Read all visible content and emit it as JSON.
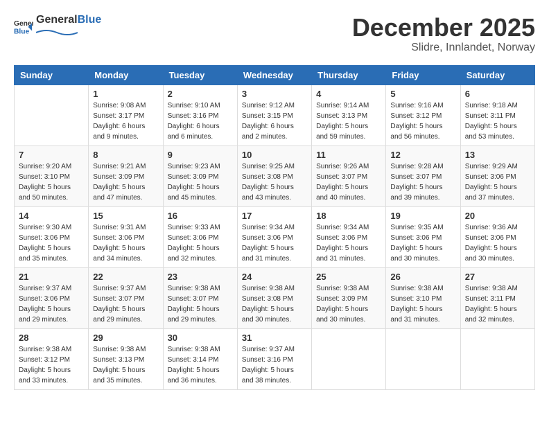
{
  "logo": {
    "general": "General",
    "blue": "Blue"
  },
  "header": {
    "month": "December 2025",
    "location": "Slidre, Innlandet, Norway"
  },
  "weekdays": [
    "Sunday",
    "Monday",
    "Tuesday",
    "Wednesday",
    "Thursday",
    "Friday",
    "Saturday"
  ],
  "weeks": [
    [
      {
        "day": "",
        "sunrise": "",
        "sunset": "",
        "daylight": ""
      },
      {
        "day": "1",
        "sunrise": "Sunrise: 9:08 AM",
        "sunset": "Sunset: 3:17 PM",
        "daylight": "Daylight: 6 hours and 9 minutes."
      },
      {
        "day": "2",
        "sunrise": "Sunrise: 9:10 AM",
        "sunset": "Sunset: 3:16 PM",
        "daylight": "Daylight: 6 hours and 6 minutes."
      },
      {
        "day": "3",
        "sunrise": "Sunrise: 9:12 AM",
        "sunset": "Sunset: 3:15 PM",
        "daylight": "Daylight: 6 hours and 2 minutes."
      },
      {
        "day": "4",
        "sunrise": "Sunrise: 9:14 AM",
        "sunset": "Sunset: 3:13 PM",
        "daylight": "Daylight: 5 hours and 59 minutes."
      },
      {
        "day": "5",
        "sunrise": "Sunrise: 9:16 AM",
        "sunset": "Sunset: 3:12 PM",
        "daylight": "Daylight: 5 hours and 56 minutes."
      },
      {
        "day": "6",
        "sunrise": "Sunrise: 9:18 AM",
        "sunset": "Sunset: 3:11 PM",
        "daylight": "Daylight: 5 hours and 53 minutes."
      }
    ],
    [
      {
        "day": "7",
        "sunrise": "Sunrise: 9:20 AM",
        "sunset": "Sunset: 3:10 PM",
        "daylight": "Daylight: 5 hours and 50 minutes."
      },
      {
        "day": "8",
        "sunrise": "Sunrise: 9:21 AM",
        "sunset": "Sunset: 3:09 PM",
        "daylight": "Daylight: 5 hours and 47 minutes."
      },
      {
        "day": "9",
        "sunrise": "Sunrise: 9:23 AM",
        "sunset": "Sunset: 3:09 PM",
        "daylight": "Daylight: 5 hours and 45 minutes."
      },
      {
        "day": "10",
        "sunrise": "Sunrise: 9:25 AM",
        "sunset": "Sunset: 3:08 PM",
        "daylight": "Daylight: 5 hours and 43 minutes."
      },
      {
        "day": "11",
        "sunrise": "Sunrise: 9:26 AM",
        "sunset": "Sunset: 3:07 PM",
        "daylight": "Daylight: 5 hours and 40 minutes."
      },
      {
        "day": "12",
        "sunrise": "Sunrise: 9:28 AM",
        "sunset": "Sunset: 3:07 PM",
        "daylight": "Daylight: 5 hours and 39 minutes."
      },
      {
        "day": "13",
        "sunrise": "Sunrise: 9:29 AM",
        "sunset": "Sunset: 3:06 PM",
        "daylight": "Daylight: 5 hours and 37 minutes."
      }
    ],
    [
      {
        "day": "14",
        "sunrise": "Sunrise: 9:30 AM",
        "sunset": "Sunset: 3:06 PM",
        "daylight": "Daylight: 5 hours and 35 minutes."
      },
      {
        "day": "15",
        "sunrise": "Sunrise: 9:31 AM",
        "sunset": "Sunset: 3:06 PM",
        "daylight": "Daylight: 5 hours and 34 minutes."
      },
      {
        "day": "16",
        "sunrise": "Sunrise: 9:33 AM",
        "sunset": "Sunset: 3:06 PM",
        "daylight": "Daylight: 5 hours and 32 minutes."
      },
      {
        "day": "17",
        "sunrise": "Sunrise: 9:34 AM",
        "sunset": "Sunset: 3:06 PM",
        "daylight": "Daylight: 5 hours and 31 minutes."
      },
      {
        "day": "18",
        "sunrise": "Sunrise: 9:34 AM",
        "sunset": "Sunset: 3:06 PM",
        "daylight": "Daylight: 5 hours and 31 minutes."
      },
      {
        "day": "19",
        "sunrise": "Sunrise: 9:35 AM",
        "sunset": "Sunset: 3:06 PM",
        "daylight": "Daylight: 5 hours and 30 minutes."
      },
      {
        "day": "20",
        "sunrise": "Sunrise: 9:36 AM",
        "sunset": "Sunset: 3:06 PM",
        "daylight": "Daylight: 5 hours and 30 minutes."
      }
    ],
    [
      {
        "day": "21",
        "sunrise": "Sunrise: 9:37 AM",
        "sunset": "Sunset: 3:06 PM",
        "daylight": "Daylight: 5 hours and 29 minutes."
      },
      {
        "day": "22",
        "sunrise": "Sunrise: 9:37 AM",
        "sunset": "Sunset: 3:07 PM",
        "daylight": "Daylight: 5 hours and 29 minutes."
      },
      {
        "day": "23",
        "sunrise": "Sunrise: 9:38 AM",
        "sunset": "Sunset: 3:07 PM",
        "daylight": "Daylight: 5 hours and 29 minutes."
      },
      {
        "day": "24",
        "sunrise": "Sunrise: 9:38 AM",
        "sunset": "Sunset: 3:08 PM",
        "daylight": "Daylight: 5 hours and 30 minutes."
      },
      {
        "day": "25",
        "sunrise": "Sunrise: 9:38 AM",
        "sunset": "Sunset: 3:09 PM",
        "daylight": "Daylight: 5 hours and 30 minutes."
      },
      {
        "day": "26",
        "sunrise": "Sunrise: 9:38 AM",
        "sunset": "Sunset: 3:10 PM",
        "daylight": "Daylight: 5 hours and 31 minutes."
      },
      {
        "day": "27",
        "sunrise": "Sunrise: 9:38 AM",
        "sunset": "Sunset: 3:11 PM",
        "daylight": "Daylight: 5 hours and 32 minutes."
      }
    ],
    [
      {
        "day": "28",
        "sunrise": "Sunrise: 9:38 AM",
        "sunset": "Sunset: 3:12 PM",
        "daylight": "Daylight: 5 hours and 33 minutes."
      },
      {
        "day": "29",
        "sunrise": "Sunrise: 9:38 AM",
        "sunset": "Sunset: 3:13 PM",
        "daylight": "Daylight: 5 hours and 35 minutes."
      },
      {
        "day": "30",
        "sunrise": "Sunrise: 9:38 AM",
        "sunset": "Sunset: 3:14 PM",
        "daylight": "Daylight: 5 hours and 36 minutes."
      },
      {
        "day": "31",
        "sunrise": "Sunrise: 9:37 AM",
        "sunset": "Sunset: 3:16 PM",
        "daylight": "Daylight: 5 hours and 38 minutes."
      },
      {
        "day": "",
        "sunrise": "",
        "sunset": "",
        "daylight": ""
      },
      {
        "day": "",
        "sunrise": "",
        "sunset": "",
        "daylight": ""
      },
      {
        "day": "",
        "sunrise": "",
        "sunset": "",
        "daylight": ""
      }
    ]
  ]
}
